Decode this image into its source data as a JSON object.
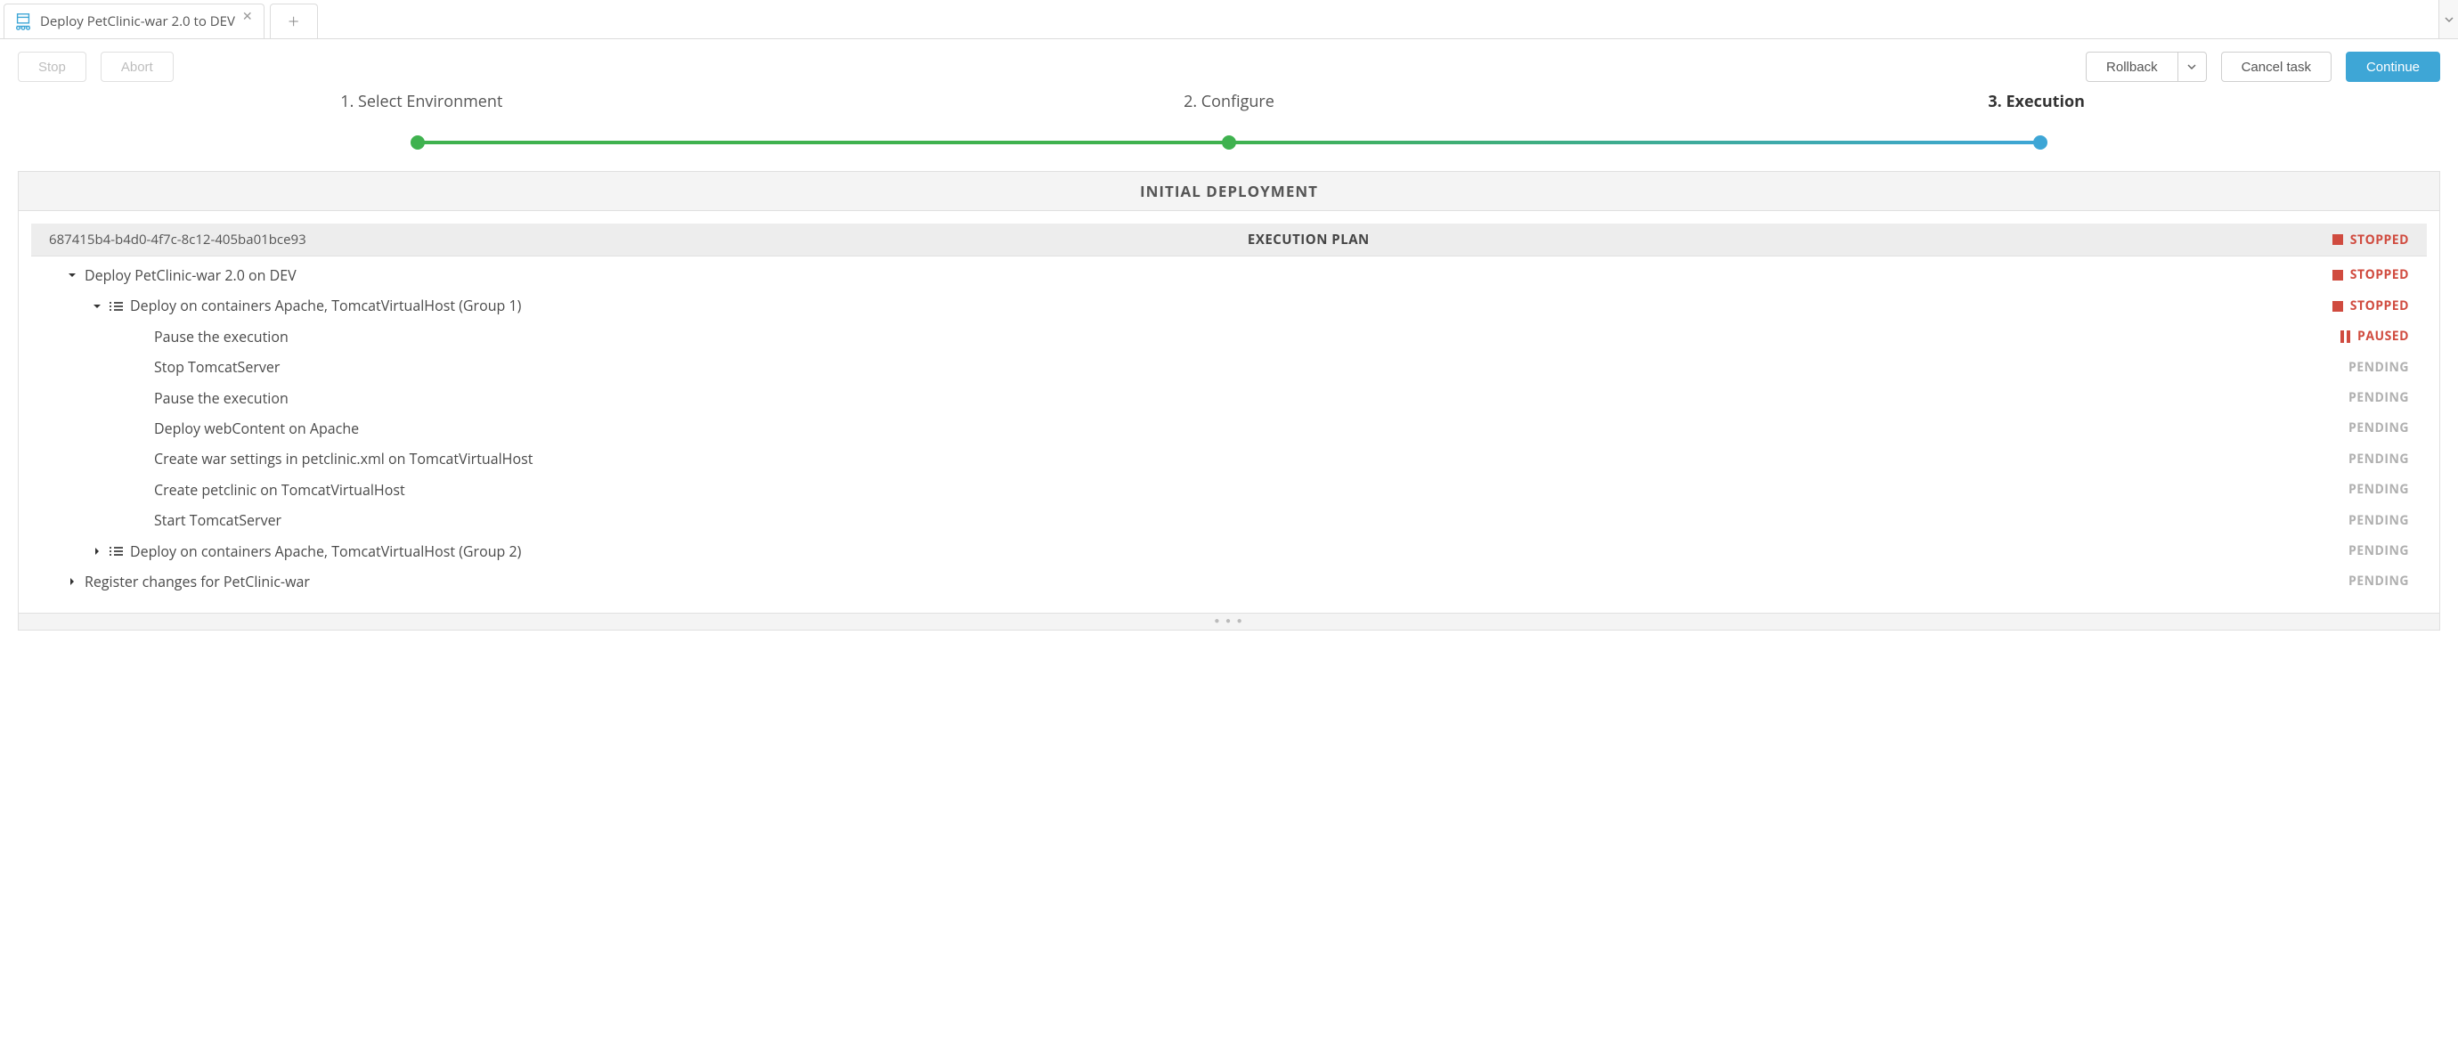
{
  "tab": {
    "title": "Deploy PetClinic-war 2.0 to DEV"
  },
  "buttons": {
    "stop": "Stop",
    "abort": "Abort",
    "rollback": "Rollback",
    "cancel_task": "Cancel task",
    "continue": "Continue"
  },
  "wizard": {
    "step1": "1. Select Environment",
    "step2": "2. Configure",
    "step3": "3. Execution"
  },
  "panel": {
    "title": "INITIAL DEPLOYMENT",
    "plan_id": "687415b4-b4d0-4f7c-8c12-405ba01bce93",
    "plan_label": "EXECUTION PLAN"
  },
  "statuses": {
    "STOPPED": "STOPPED",
    "PAUSED": "PAUSED",
    "PENDING": "PENDING"
  },
  "tree": [
    {
      "indent": 0,
      "caret": "down",
      "icon": null,
      "label": "Deploy PetClinic-war 2.0 on DEV",
      "status": "STOPPED"
    },
    {
      "indent": 1,
      "caret": "down",
      "icon": "group",
      "label": "Deploy on containers Apache, TomcatVirtualHost (Group 1)",
      "status": "STOPPED"
    },
    {
      "indent": 2,
      "caret": null,
      "icon": null,
      "label": "Pause the execution",
      "status": "PAUSED"
    },
    {
      "indent": 2,
      "caret": null,
      "icon": null,
      "label": "Stop TomcatServer",
      "status": "PENDING"
    },
    {
      "indent": 2,
      "caret": null,
      "icon": null,
      "label": "Pause the execution",
      "status": "PENDING"
    },
    {
      "indent": 2,
      "caret": null,
      "icon": null,
      "label": "Deploy webContent on Apache",
      "status": "PENDING"
    },
    {
      "indent": 2,
      "caret": null,
      "icon": null,
      "label": "Create war settings in petclinic.xml on TomcatVirtualHost",
      "status": "PENDING"
    },
    {
      "indent": 2,
      "caret": null,
      "icon": null,
      "label": "Create petclinic on TomcatVirtualHost",
      "status": "PENDING"
    },
    {
      "indent": 2,
      "caret": null,
      "icon": null,
      "label": "Start TomcatServer",
      "status": "PENDING"
    },
    {
      "indent": 1,
      "caret": "right",
      "icon": "group",
      "label": "Deploy on containers Apache, TomcatVirtualHost (Group 2)",
      "status": "PENDING"
    },
    {
      "indent": 0,
      "caret": "right",
      "icon": null,
      "label": "Register changes for PetClinic-war",
      "status": "PENDING"
    }
  ]
}
